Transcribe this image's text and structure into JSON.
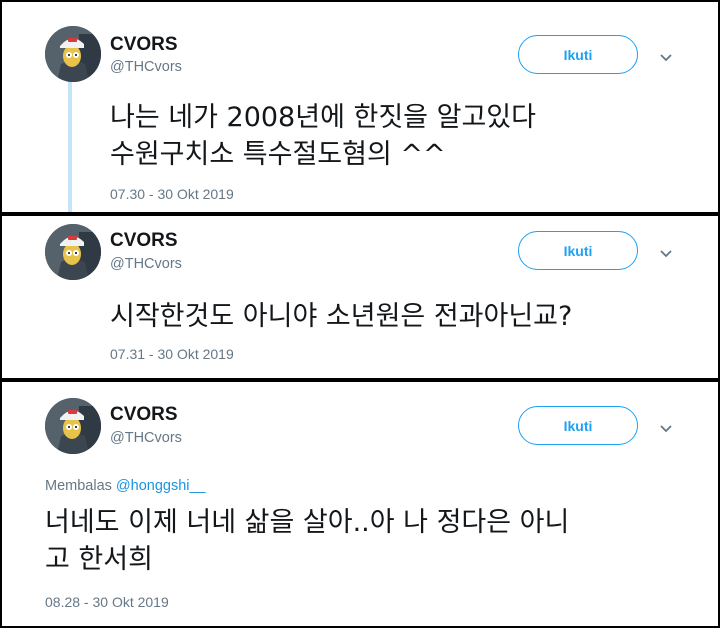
{
  "colors": {
    "accent": "#1da1f2",
    "secondary_text": "#657786",
    "thread_line": "#c4e4f7"
  },
  "tweets": [
    {
      "name": "CVORS",
      "handle": "@THCvors",
      "follow_label": "Ikuti",
      "menu_icon": "chevron-down-icon",
      "text_lines": [
        "나는 네가 2008년에 한짓을 알고있다",
        "수원구치소 특수절도혐의 ^^"
      ],
      "timestamp": "07.30 - 30 Okt 2019"
    },
    {
      "name": "CVORS",
      "handle": "@THCvors",
      "follow_label": "Ikuti",
      "menu_icon": "chevron-down-icon",
      "text_lines": [
        "시작한것도 아니야 소년원은 전과아닌교?"
      ],
      "timestamp": "07.31 - 30 Okt 2019"
    },
    {
      "name": "CVORS",
      "handle": "@THCvors",
      "follow_label": "Ikuti",
      "menu_icon": "chevron-down-icon",
      "reply_prefix": "Membalas",
      "reply_mention": "@honggshi__",
      "text_lines": [
        "너네도 이제 너네 삶을 살아..아 나 정다은 아니",
        "고 한서희"
      ],
      "timestamp": "08.28 - 30 Okt 2019"
    }
  ]
}
